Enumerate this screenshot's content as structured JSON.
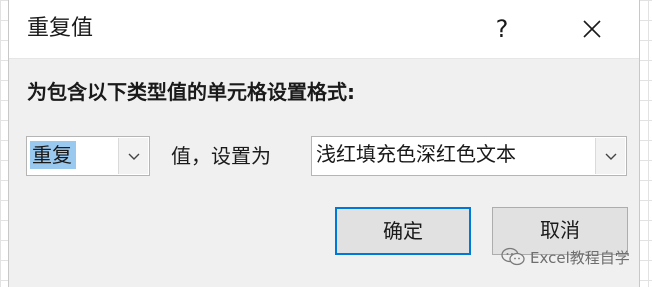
{
  "window": {
    "title": "重复值",
    "help_label": "?"
  },
  "instruction": "为包含以下类型值的单元格设置格式:",
  "duplicate_select": {
    "selected": "重复"
  },
  "mid_label": "值，设置为",
  "format_select": {
    "selected": "浅红填充色深红色文本"
  },
  "buttons": {
    "ok_label": "确定",
    "cancel_label": "取消"
  },
  "watermark": {
    "text": "Excel教程自学",
    "icon": "wechat-icon"
  },
  "colors": {
    "dialog_bg": "#f0f0f0",
    "selection_highlight": "#99c9ef",
    "default_button_border": "#0078d7"
  }
}
